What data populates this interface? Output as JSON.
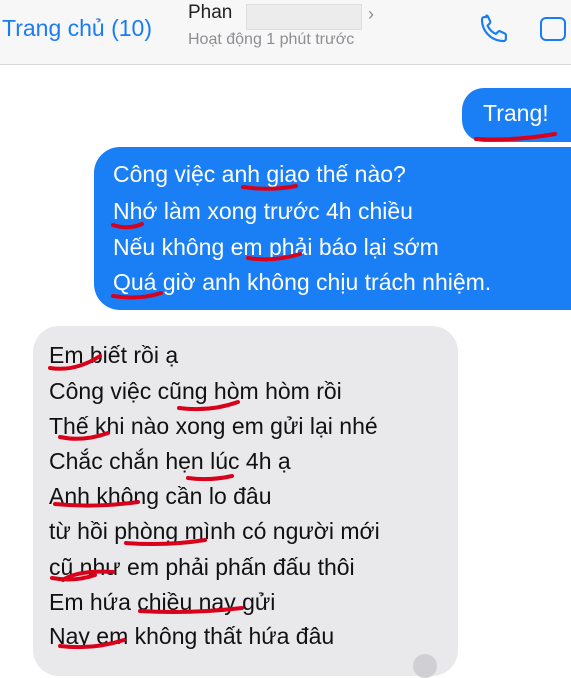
{
  "header": {
    "back_label": "Trang chủ (10)",
    "contact_name": "Phan",
    "status": "Hoạt động 1 phút trước",
    "chevron_icon": "chevron-right-icon",
    "phone_icon": "phone-icon",
    "video_icon": "video-call-icon"
  },
  "messages": {
    "sent_1": "Trang!",
    "sent_2": [
      "Công việc anh giao thế nào?",
      "Nhớ làm xong trước 4h chiều",
      "Nếu không em phải báo lại sớm",
      "Quá giờ anh không chịu trách nhiệm."
    ],
    "received": [
      "Em biết rồi ạ",
      "Công việc cũng hòm hòm rồi",
      "Thế khi nào xong em gửi lại nhé",
      "Chắc chắn hẹn lúc 4h ạ",
      "Anh không cần lo đâu",
      "từ hồi phòng mình có người mới",
      "cũ như em phải phấn đấu thôi",
      "Em hứa chiều nay gửi",
      "Nay em không thất hứa đâu"
    ]
  },
  "colors": {
    "accent": "#1a7cf5",
    "sent_bubble": "#1a7ff5",
    "received_bubble": "#e9e9eb",
    "ink_marks": "#d9001b"
  }
}
